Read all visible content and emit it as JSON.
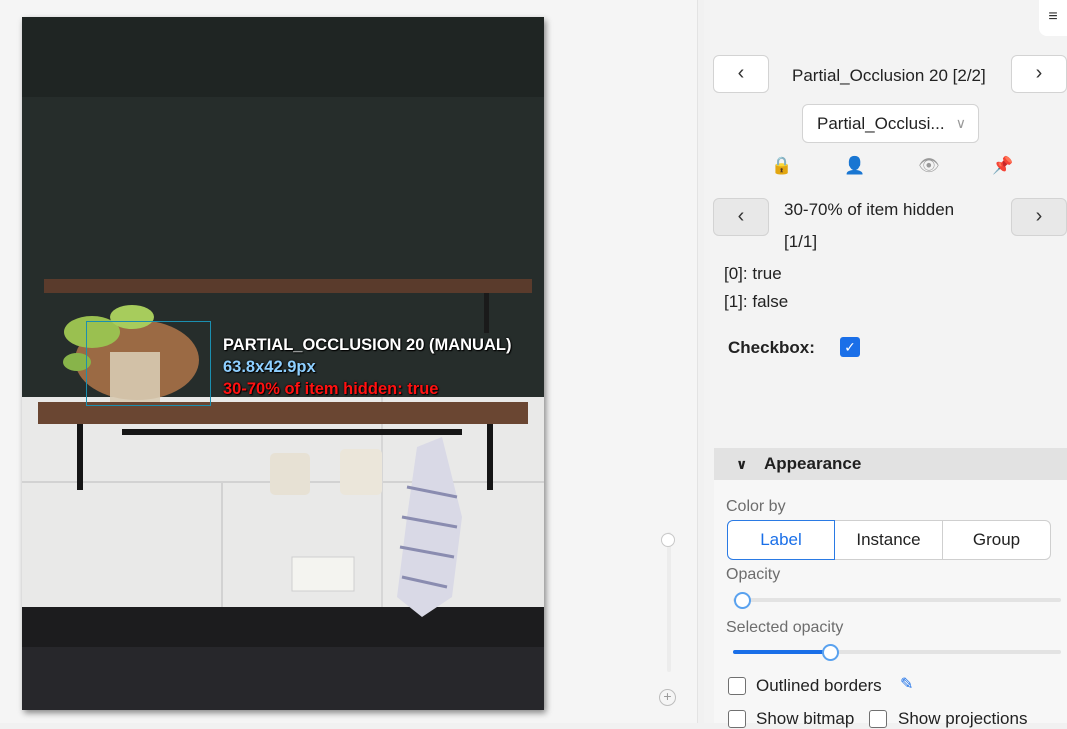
{
  "canvas": {
    "label_line1": "PARTIAL_OCCLUSION 20 (MANUAL)",
    "label_line2": "63.8x42.9px",
    "label_line3": "30-70% of item hidden: true",
    "zoom_plus": "+"
  },
  "panel": {
    "menu_icon": "≡",
    "prev_label": "‹",
    "next_label": "›",
    "object_title": "Partial_Occlusion 20",
    "object_index": "[2/2]",
    "label_select": "Partial_Occlusi...",
    "dropdown_icon": "chevron-down-icon",
    "icons": {
      "lock": "🔒",
      "user": "👤",
      "eye": "👁",
      "pin": "📌"
    },
    "attribute_name": "30-70% of item hidden",
    "attribute_index": "[1/1]",
    "values": [
      {
        "idx": "[0]",
        "val": ": true"
      },
      {
        "idx": "[1]",
        "val": ": false"
      }
    ],
    "checkbox_label": "Checkbox:",
    "checkbox_checked": "✓"
  },
  "appearance": {
    "title": "Appearance",
    "color_by_label": "Color by",
    "color_by_options": [
      "Label",
      "Instance",
      "Group"
    ],
    "color_by_selected": "Label",
    "opacity_label": "Opacity",
    "opacity_value": 0.03,
    "selected_opacity_label": "Selected opacity",
    "selected_opacity_value": 0.3,
    "outlined_borders_label": "Outlined borders",
    "show_bitmap_label": "Show bitmap",
    "show_projections_label": "Show projections",
    "accent_color": "#1a6fe8"
  }
}
